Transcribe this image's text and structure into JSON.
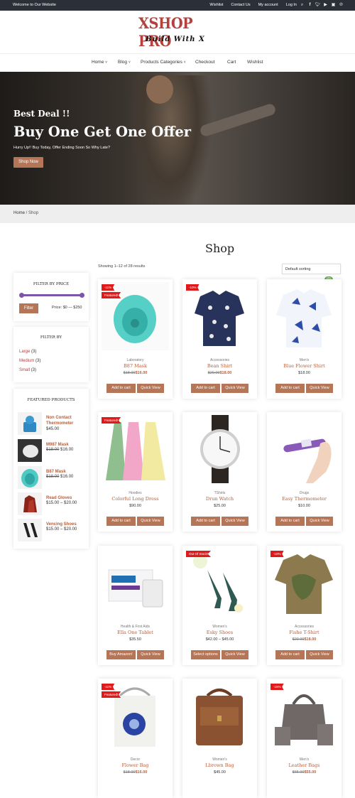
{
  "topbar": {
    "welcome": "Welcome to Our Website",
    "links": [
      "Wishlist",
      "Contact Us",
      "My account",
      "Log In"
    ],
    "icons": [
      "search-icon",
      "facebook-icon",
      "twitter-icon",
      "youtube-icon",
      "instagram-icon",
      "pinterest-icon"
    ]
  },
  "logo": {
    "title": "XSHOP PRO",
    "tagline": "Build With X"
  },
  "nav": {
    "home": "Home",
    "blog": "Blog",
    "categories": "Products Categories",
    "checkout": "Checkout",
    "cart": "Cart",
    "wishlist": "Wishlist"
  },
  "hero": {
    "kicker": "Best Deal !!",
    "title": "Buy One Get One Offer",
    "subtitle": "Hurry Up!! Buy Today, Offer Ending Soon So Why Late?",
    "button": "Shop Now"
  },
  "breadcrumb": {
    "home": "Home",
    "sep": " / ",
    "current": "Shop"
  },
  "shop": {
    "title": "Shop",
    "showing": "Showing 1–12 of 28 results",
    "sort": "Default sorting",
    "cart_count": "(0)"
  },
  "filter_price": {
    "title": "FILTER BY PRICE",
    "button": "Filter",
    "range": "Price: $0 — $250"
  },
  "filter_by": {
    "title": "FILTER BY",
    "items": [
      {
        "label": "Large",
        "count": "(3)"
      },
      {
        "label": "Medium",
        "count": "(3)"
      },
      {
        "label": "Small",
        "count": "(3)"
      }
    ]
  },
  "featured": {
    "title": "FEATURED PRODUCTS",
    "items": [
      {
        "name": "Non Contact Thermometer",
        "old": "",
        "price": "$45.00"
      },
      {
        "name": "M987 Mask",
        "old": "$18.00",
        "price": "$16.00"
      },
      {
        "name": "B87 Mask",
        "old": "$18.00",
        "price": "$16.00"
      },
      {
        "name": "Read Gloves",
        "old": "",
        "price": "$15.00 – $20.00"
      },
      {
        "name": "Vencing Shoes",
        "old": "",
        "price": "$15.00 – $20.00"
      }
    ]
  },
  "products": [
    {
      "badge": "-11%",
      "badge2": "Featured!",
      "cat": "Laboratory",
      "name": "B87 Mask",
      "old": "$18.00",
      "price": "$16.00",
      "b1": "Add to cart",
      "b2": "Quick View"
    },
    {
      "badge": "-10%",
      "badge2": "",
      "cat": "Accessories",
      "name": "Bean Shirt",
      "old": "$20.00",
      "price": "$18.00",
      "b1": "Add to cart",
      "b2": "Quick View"
    },
    {
      "badge": "",
      "badge2": "",
      "cat": "Men's",
      "name": "Blue Flower Shirt",
      "old": "",
      "price": "$18.00",
      "b1": "Add to cart",
      "b2": "Quick View"
    },
    {
      "badge": "Featured!",
      "badge2": "",
      "cat": "Hoodies",
      "name": "Colorful Long Dress",
      "old": "",
      "price": "$90.00",
      "b1": "Add to cart",
      "b2": "Quick View"
    },
    {
      "badge": "",
      "badge2": "",
      "cat": "TShirts",
      "name": "Drun Watch",
      "old": "",
      "price": "$25.00",
      "b1": "Add to cart",
      "b2": "Quick View"
    },
    {
      "badge": "",
      "badge2": "",
      "cat": "Drugs",
      "name": "Easy Thermometer",
      "old": "",
      "price": "$10.00",
      "b1": "Add to cart",
      "b2": "Quick View"
    },
    {
      "badge": "",
      "badge2": "",
      "cat": "Health & First Aids",
      "name": "Ella One Tablet",
      "old": "",
      "price": "$35.50",
      "b1": "Buy Amazon!",
      "b2": "Quick View"
    },
    {
      "badge": "Out Of Stock!",
      "badge2": "",
      "cat": "Women's",
      "name": "Esky Shoes",
      "old": "",
      "price": "$42.00 – $45.00",
      "b1": "Select options",
      "b2": "Quick View"
    },
    {
      "badge": "-10%",
      "badge2": "",
      "cat": "Accessories",
      "name": "Fishe T-Shirt",
      "old": "$20.00",
      "price": "$18.00",
      "b1": "Add to cart",
      "b2": "Quick View"
    },
    {
      "badge": "-11%",
      "badge2": "Featured!",
      "cat": "Decor",
      "name": "Flower Bag",
      "old": "$18.00",
      "price": "$16.00",
      "b1": "",
      "b2": ""
    },
    {
      "badge": "",
      "badge2": "",
      "cat": "Women's",
      "name": "Lbrown Bag",
      "old": "",
      "price": "$45.00",
      "b1": "",
      "b2": ""
    },
    {
      "badge": "-15%",
      "badge2": "",
      "cat": "Men's",
      "name": "Leather Bags",
      "old": "$65.00",
      "price": "$55.00",
      "b1": "",
      "b2": ""
    }
  ]
}
